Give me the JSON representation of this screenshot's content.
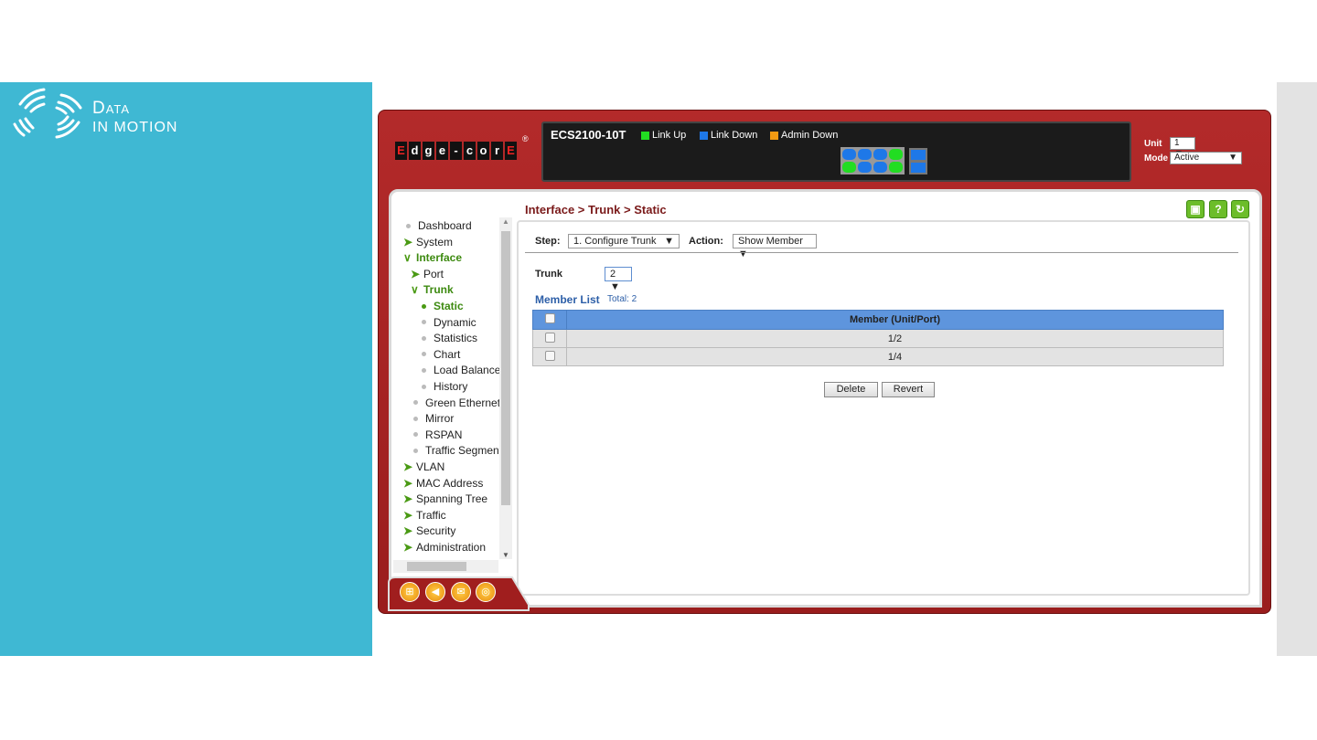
{
  "slide": {
    "logo_line1": "Data",
    "logo_line2": "in motion",
    "accent": "#3fb8d3"
  },
  "device": {
    "brand": [
      "E",
      "d",
      "g",
      "e",
      "-",
      "c",
      "o",
      "r",
      "E"
    ],
    "model": "ECS2100-10T",
    "legend": [
      {
        "label": "Link Up",
        "color": "#22dd22"
      },
      {
        "label": "Link Down",
        "color": "#1e78e8"
      },
      {
        "label": "Admin Down",
        "color": "#f39a12"
      }
    ],
    "ports_top": [
      "down",
      "down",
      "down",
      "up"
    ],
    "ports_bottom": [
      "up",
      "down",
      "down",
      "up"
    ],
    "unit_label": "Unit",
    "unit_value": "1",
    "mode_label": "Mode",
    "mode_value": "Active"
  },
  "breadcrumb": "Interface > Trunk > Static",
  "toolbar": {
    "save": "save-icon",
    "help": "?",
    "refresh": "refresh-icon"
  },
  "nav": [
    {
      "label": "Dashboard",
      "type": "dot",
      "level": 0
    },
    {
      "label": "System",
      "type": "arrow",
      "level": 0
    },
    {
      "label": "Interface",
      "type": "open",
      "level": 0
    },
    {
      "label": "Port",
      "type": "arrow",
      "level": 1
    },
    {
      "label": "Trunk",
      "type": "open",
      "level": 1
    },
    {
      "label": "Static",
      "type": "current",
      "level": 2
    },
    {
      "label": "Dynamic",
      "type": "dot",
      "level": 2
    },
    {
      "label": "Statistics",
      "type": "dot",
      "level": 2
    },
    {
      "label": "Chart",
      "type": "dot",
      "level": 2
    },
    {
      "label": "Load Balance",
      "type": "dot",
      "level": 2
    },
    {
      "label": "History",
      "type": "dot",
      "level": 2
    },
    {
      "label": "Green Ethernet",
      "type": "dot",
      "level": 1
    },
    {
      "label": "Mirror",
      "type": "dot",
      "level": 1
    },
    {
      "label": "RSPAN",
      "type": "dot",
      "level": 1
    },
    {
      "label": "Traffic Segment",
      "type": "dot",
      "level": 1
    },
    {
      "label": "VLAN",
      "type": "arrow",
      "level": 0
    },
    {
      "label": "MAC Address",
      "type": "arrow",
      "level": 0
    },
    {
      "label": "Spanning Tree",
      "type": "arrow",
      "level": 0
    },
    {
      "label": "Traffic",
      "type": "arrow",
      "level": 0
    },
    {
      "label": "Security",
      "type": "arrow",
      "level": 0
    },
    {
      "label": "Administration",
      "type": "arrow",
      "level": 0
    }
  ],
  "form": {
    "step_label": "Step:",
    "step_value": "1. Configure Trunk",
    "action_label": "Action:",
    "action_value": "Show Member",
    "trunk_label": "Trunk",
    "trunk_value": "2"
  },
  "member_list": {
    "title": "Member List",
    "total": "Total: 2",
    "header": "Member (Unit/Port)",
    "rows": [
      "1/2",
      "1/4"
    ]
  },
  "buttons": {
    "delete": "Delete",
    "revert": "Revert"
  }
}
